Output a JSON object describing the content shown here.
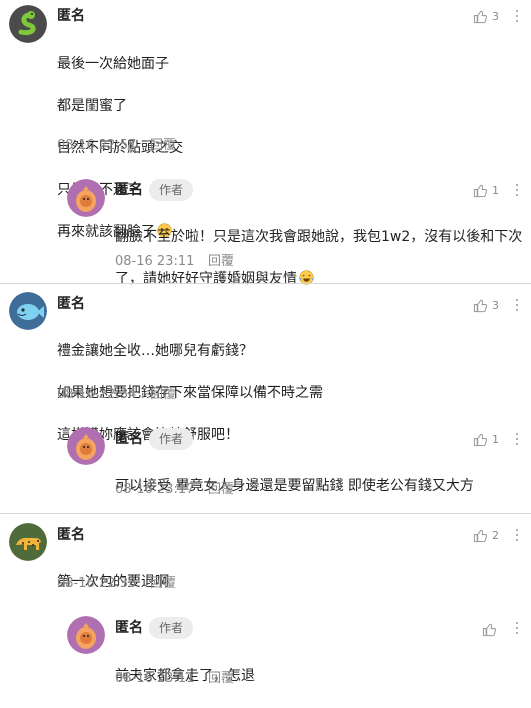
{
  "reply_label": "回覆",
  "author_badge": "作者",
  "threads": [
    {
      "comment": {
        "author": "匿名",
        "lines": [
          "最後一次給她面子",
          "都是閨蜜了",
          "自然不同於點頭之交",
          "只是事不過三",
          "再來就該翻臉了"
        ],
        "emoji": "unamused-face",
        "timestamp": "08-16 22:57",
        "likes": "3",
        "avatar": "snake-avatar"
      },
      "reply": {
        "author": "匿名",
        "lines": [
          "翻臉不至於啦！只是這次我會跟她說，我包1w2，沒有以後和下次",
          "了，請她好好守護婚姻與友情"
        ],
        "emoji": "laughing-face",
        "timestamp": "08-16 23:11",
        "likes": "1",
        "avatar": "chick-avatar"
      }
    },
    {
      "comment": {
        "author": "匿名",
        "lines": [
          "禮金讓她全收…她哪兒有虧錢？",
          "如果她想要把錢存下來當保障以備不時之需",
          "這樣講妳應該會比較舒服吧！"
        ],
        "timestamp": "08-16 22:34",
        "likes": "3",
        "avatar": "fish-avatar"
      },
      "reply": {
        "author": "匿名",
        "lines": [
          "可以接受  畢竟女人身邊還是要留點錢  即使老公有錢又大方"
        ],
        "timestamp": "08-16 23:17",
        "likes": "1",
        "avatar": "chick-avatar"
      }
    },
    {
      "comment": {
        "author": "匿名",
        "lines": [
          "第一次包的要退啊"
        ],
        "timestamp": "08-16 22:33",
        "likes": "2",
        "avatar": "leopard-avatar"
      },
      "reply": {
        "author": "匿名",
        "lines": [
          "前夫家都拿走了，怎退"
        ],
        "timestamp": "08-16 23:11",
        "likes": "",
        "avatar": "chick-avatar"
      }
    }
  ]
}
